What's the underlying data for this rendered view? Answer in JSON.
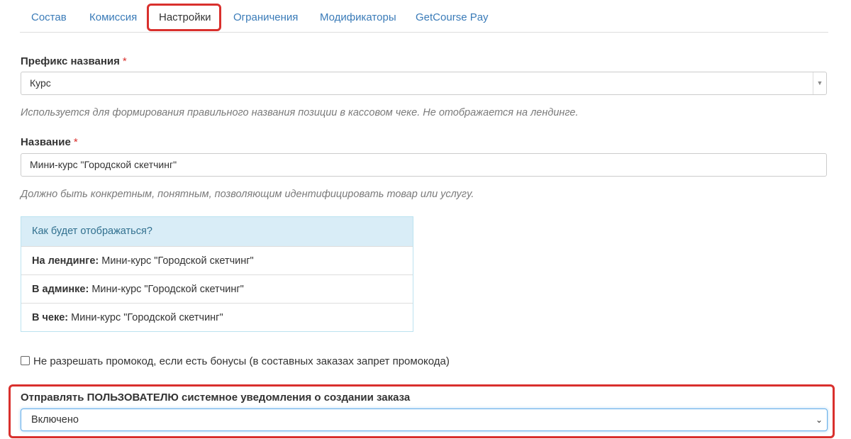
{
  "tabs": [
    {
      "label": "Состав"
    },
    {
      "label": "Комиссия"
    },
    {
      "label": "Настройки"
    },
    {
      "label": "Ограничения"
    },
    {
      "label": "Модификаторы"
    },
    {
      "label": "GetCourse Pay"
    }
  ],
  "active_tab": "Настройки",
  "prefix": {
    "label": "Префикс названия",
    "required_mark": "*",
    "value": "Курс",
    "hint": "Используется для формирования правильного названия позиции в кассовом чеке. Не отображается на лендинге."
  },
  "name": {
    "label": "Название",
    "required_mark": "*",
    "value": "Мини-курс \"Городской скетчинг\"",
    "hint": "Должно быть конкретным, понятным, позволяющим идентифицировать товар или услугу."
  },
  "preview": {
    "heading": "Как будет отображаться?",
    "rows": [
      {
        "key": "На лендинге:",
        "value": " Мини-курс \"Городской скетчинг\""
      },
      {
        "key": "В админке:",
        "value": " Мини-курс \"Городской скетчинг\""
      },
      {
        "key": "В чеке:",
        "value": " Мини-курс \"Городской скетчинг\""
      }
    ]
  },
  "promo_checkbox": {
    "label": "Не разрешать промокод, если есть бонусы (в составных заказах запрет промокода)",
    "checked": false
  },
  "notify": {
    "label": "Отправлять ПОЛЬЗОВАТЕЛЮ системное уведомления о создании заказа",
    "value": "Включено"
  },
  "colors": {
    "link": "#3a7bb8",
    "highlight": "#d9302d",
    "panel_head_bg": "#d9edf7",
    "panel_head_text": "#31708f",
    "hint": "#7a7a7a"
  }
}
